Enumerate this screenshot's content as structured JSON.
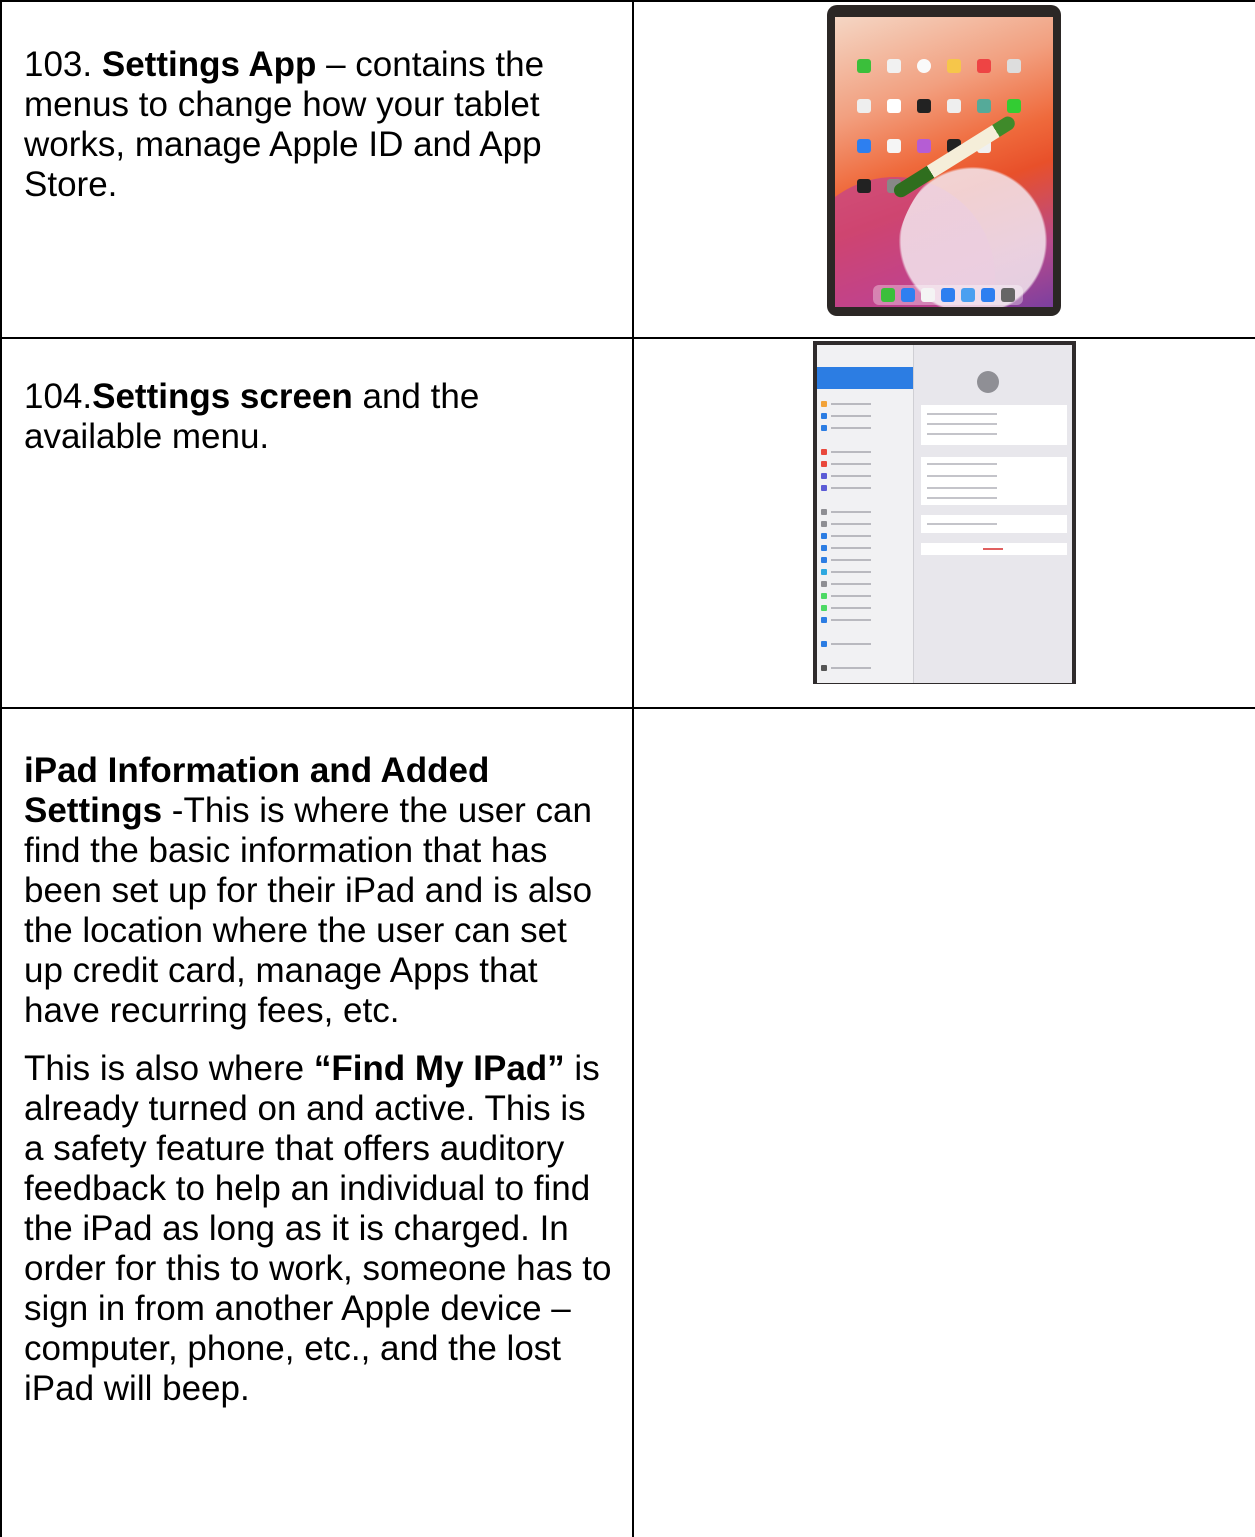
{
  "rows": [
    {
      "number": "103.",
      "bold": "Settings App",
      "text": " – contains the menus to change how your tablet works, manage Apple ID and App Store.",
      "image": "ipad-home-screen-photo"
    },
    {
      "number": "104.",
      "bold": "Settings screen",
      "text": " and the available menu.",
      "image": "ipad-settings-screen-photo"
    },
    {
      "heading": "iPad Information and Added Settings",
      "text": " -This is where the user can find the basic information that has been set up for their iPad and is also the location where the user can set up credit card, manage Apps that have recurring fees, etc.",
      "p2_before": "This is also where ",
      "p2_bold": "“Find My IPad”",
      "p2_after": " is already turned on and active. This is a safety feature that offers auditory feedback to help an individual to find the iPad as long as it is charged. In order for this to work, someone has to sign in from another Apple device – computer, phone, etc., and the lost iPad will beep."
    }
  ],
  "colors": {
    "border": "#000000",
    "background": "#ffffff"
  }
}
